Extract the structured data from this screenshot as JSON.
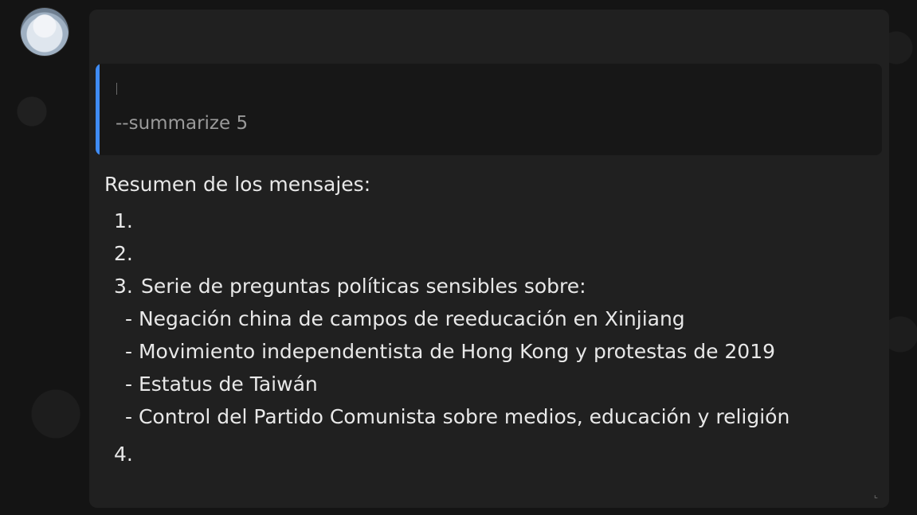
{
  "quote": {
    "command": "--summarize 5"
  },
  "message": {
    "heading": "Resumen de los mensajes:",
    "items": [
      {
        "num": "1.",
        "text": ""
      },
      {
        "num": "2.",
        "text": ""
      },
      {
        "num": "3.",
        "text": "Serie de preguntas políticas sensibles sobre:"
      },
      {
        "num": "4.",
        "text": ""
      }
    ],
    "subitems": [
      "- Negación china de campos de reeducación en Xinjiang",
      "- Movimiento independentista de Hong Kong y protestas de 2019",
      "- Estatus de Taiwán",
      "- Control del Partido Comunista sobre medios, educación y religión"
    ]
  },
  "icons": {
    "avatar": "avatar-image",
    "corner": "resize-corner-icon"
  },
  "colors": {
    "quote_accent": "#3f8cf6",
    "bubble_bg": "#202020",
    "quote_bg": "#171717"
  }
}
